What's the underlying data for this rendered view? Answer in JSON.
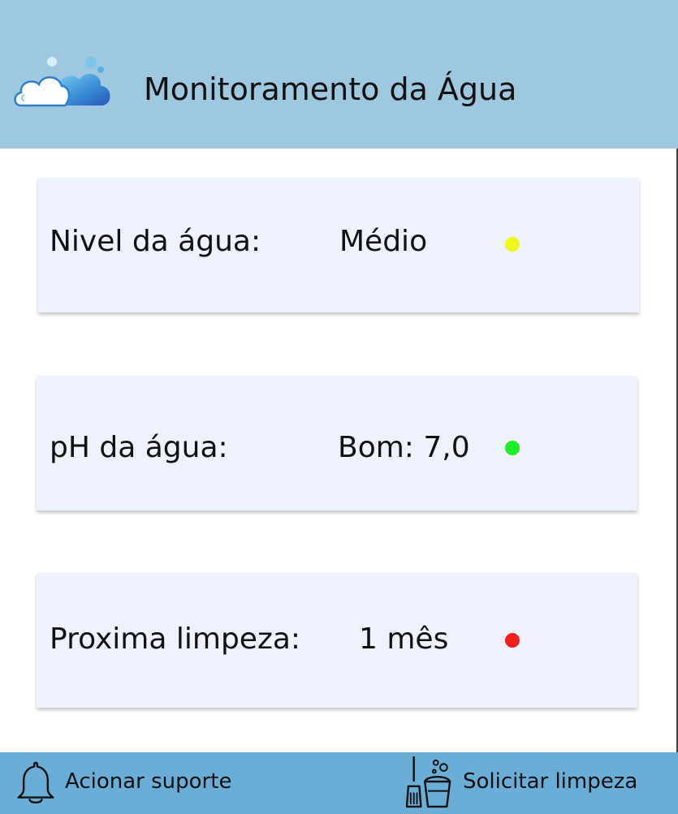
{
  "header": {
    "title": "Monitoramento da Água",
    "logo_icon": "cloud-icon"
  },
  "cards": [
    {
      "label": "Nivel da água:",
      "value": "Médio",
      "status_color": "#f0f51a"
    },
    {
      "label": "pH da água:",
      "value": "Bom: 7,0",
      "status_color": "#1ef026"
    },
    {
      "label": "Proxima limpeza:",
      "value": "1 mês",
      "status_color": "#f51f1a"
    }
  ],
  "footer": {
    "support": {
      "label": "Acionar suporte",
      "icon": "bell-icon"
    },
    "cleaning": {
      "label": "Solicitar limpeza",
      "icon": "cleaning-bucket-icon"
    }
  },
  "colors": {
    "header_bg": "#9ec8e0",
    "footer_bg": "#6aaed8",
    "card_bg": "#eef2fd"
  }
}
